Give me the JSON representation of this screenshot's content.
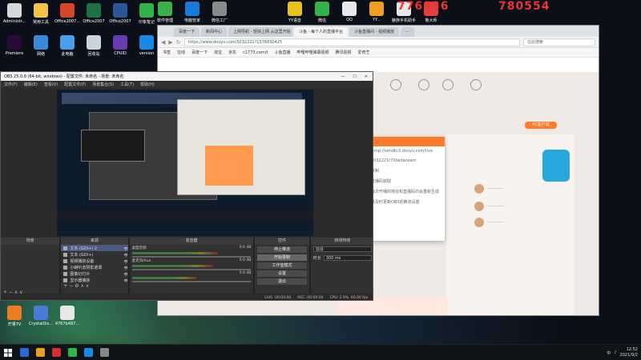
{
  "desktop": {
    "left_icons": [
      {
        "label": "Administr...",
        "color": "#d8d8d8"
      },
      {
        "label": "常用工具",
        "color": "#f2c24c"
      },
      {
        "label": "Office2007...\n幻灯片PPT",
        "color": "#d24726"
      },
      {
        "label": "Office2007\n表格",
        "color": "#1e7145"
      },
      {
        "label": "Office2007\n文字",
        "color": "#2b579a"
      },
      {
        "label": "印象笔记",
        "color": "#2fb34a"
      }
    ],
    "left_icons_row2": [
      {
        "label": "Premiere\nCC2019",
        "color": "#2a0a3a"
      },
      {
        "label": "网络",
        "color": "#3a8ad8"
      },
      {
        "label": "此电脑",
        "color": "#4aa0e8"
      },
      {
        "label": "回收站",
        "color": "#c8d4e0"
      },
      {
        "label": "CPUID\nCPU-Z",
        "color": "#6a3ab0"
      },
      {
        "label": "version",
        "color": "#1a8ae8"
      }
    ],
    "top_icons": [
      {
        "label": "软件管理",
        "color": "#3ab04a"
      },
      {
        "label": "电脑管家",
        "color": "#1a7ad8"
      },
      {
        "label": "微信工厂",
        "color": "#8a8a8a"
      },
      {
        "label": "YY语音",
        "color": "#e8c020"
      },
      {
        "label": "微信",
        "color": "#2fb34a"
      },
      {
        "label": "QQ",
        "color": "#e8e8e8"
      },
      {
        "label": "YY...",
        "color": "#f0a020"
      },
      {
        "label": "魅族手机助手",
        "color": "#e8e8e8"
      },
      {
        "label": "鲁大师",
        "color": "#e04040"
      }
    ],
    "bottom_icons": [
      {
        "label": "芒果TV",
        "color": "#f07a20"
      },
      {
        "label": "CrystalDis...",
        "color": "#4a7ad8"
      },
      {
        "label": "4767b487...",
        "color": "#e8e8e8"
      }
    ],
    "watermark_a": "776836",
    "watermark_b": "780554"
  },
  "browser": {
    "tabs": [
      "百度一下",
      "新闻中心",
      "上网导航 - 轻快上网 从这里开始",
      "斗鱼 - 每个人的直播平台",
      "斗鱼直播间 - 视频播放",
      "..."
    ],
    "url": "https://www.douyu.com/5032221?1576830425",
    "search_placeholder": "在此搜索",
    "bookmarks": [
      "书签",
      "在线",
      "百度一下",
      "淘宝",
      "京东",
      "c1773.com/t",
      "斗鱼直播",
      "哔哩哔哩弹幕视频",
      "腾讯视频",
      "爱奇艺"
    ],
    "pc_btn": "PC客户端",
    "dialog_lines": [
      "rtmp://sendtc3.douyu.com/live",
      "5032221r7XIwdaoxam",
      "复制",
      "直播码获取",
      "每次开播的地址和直播码均会重新生成",
      "请及时更新OBS的推流设置"
    ]
  },
  "obs": {
    "title": "OBS 25.0.8 (64-bit, windows) - 配置文件: 未命名 - 场景: 未命名",
    "menu": [
      "文件(F)",
      "编辑(E)",
      "查看(V)",
      "配置文件(P)",
      "场景集合(S)",
      "工具(T)",
      "帮助(H)"
    ],
    "docks": {
      "scenes": "场景",
      "sources": "来源",
      "mixer": "混音器",
      "controls": "控件",
      "transitions": "转场特效"
    },
    "sources": [
      {
        "name": "文本 (GDI+) 2",
        "selected": true
      },
      {
        "name": "文本 (GDI+)",
        "selected": false
      },
      {
        "name": "视频捕获设备",
        "selected": false
      },
      {
        "name": "小喇叭去阴影遮罩",
        "selected": false
      },
      {
        "name": "图像幻灯片",
        "selected": false
      },
      {
        "name": "显示器捕获",
        "selected": false
      }
    ],
    "mixer": [
      {
        "name": "桌面音频",
        "db": "0.0 dB",
        "level": 0.72
      },
      {
        "name": "麦克风/Aux",
        "db": "0.0 dB",
        "level": 0.68
      },
      {
        "name": "",
        "db": "0.0 dB",
        "level": 0.55
      }
    ],
    "controls": [
      "停止推流",
      "开始录制",
      "工作室模式",
      "设置",
      "退出"
    ],
    "transition": {
      "type": "淡出",
      "duration_label": "时长",
      "duration": "300 ms"
    },
    "status": [
      "LIVE: 00:00:00",
      "REC: 00:00:00",
      "CPU: 2.9%, 60.00 fps"
    ]
  },
  "taskbar": {
    "apps": [
      {
        "color": "#2a6ad8"
      },
      {
        "color": "#e8a020"
      },
      {
        "color": "#d03030"
      },
      {
        "color": "#2fb34a"
      },
      {
        "color": "#1a8ae8"
      },
      {
        "color": "#888888"
      }
    ],
    "time": "12:52",
    "date": "2021/9/2",
    "lang": "中"
  }
}
